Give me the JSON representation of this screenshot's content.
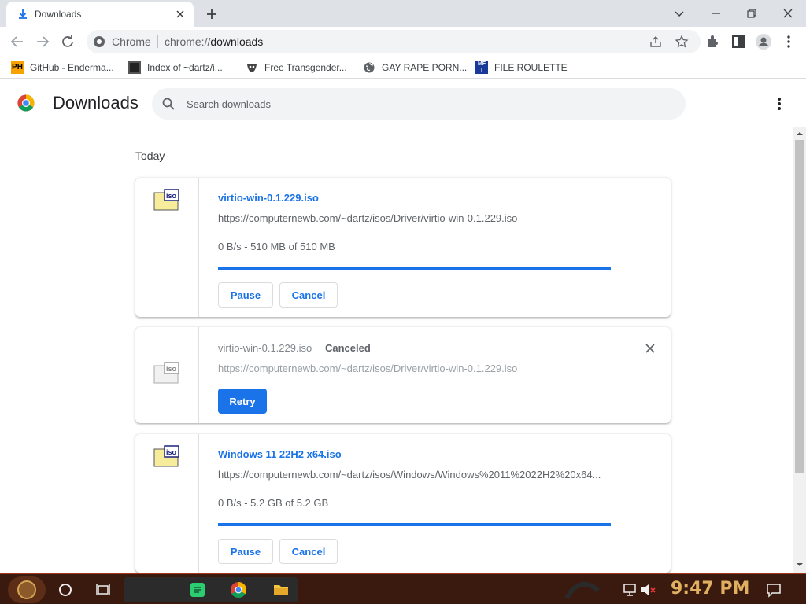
{
  "tab": {
    "title": "Downloads"
  },
  "omnibox": {
    "chip": "Chrome",
    "url_scheme": "chrome://",
    "url_path": "downloads"
  },
  "bookmarks": [
    {
      "label": "GitHub - Enderma...",
      "icon": "ph-icon"
    },
    {
      "label": "Index of ~dartz/i...",
      "icon": "folder-icon"
    },
    {
      "label": "Free Transgender...",
      "icon": "mask-icon"
    },
    {
      "label": "GAY RAPE PORN...",
      "icon": "globe-icon"
    },
    {
      "label": "FILE ROULETTE",
      "icon": "mft-icon"
    }
  ],
  "header": {
    "title": "Downloads",
    "search_placeholder": "Search downloads"
  },
  "section": {
    "label": "Today"
  },
  "downloads": [
    {
      "name": "virtio-win-0.1.229.iso",
      "url": "https://computernewb.com/~dartz/isos/Driver/virtio-win-0.1.229.iso",
      "progress_text": "0 B/s - 510 MB of 510 MB",
      "progress_fraction": 0.999,
      "pause_label": "Pause",
      "cancel_label": "Cancel"
    },
    {
      "name": "virtio-win-0.1.229.iso",
      "status": "Canceled",
      "url": "https://computernewb.com/~dartz/isos/Driver/virtio-win-0.1.229.iso",
      "retry_label": "Retry"
    },
    {
      "name": "Windows 11 22H2 x64.iso",
      "url": "https://computernewb.com/~dartz/isos/Windows/Windows%2011%2022H2%20x64...",
      "progress_text": "0 B/s - 5.2 GB of 5.2 GB",
      "progress_fraction": 0.999,
      "pause_label": "Pause",
      "cancel_label": "Cancel"
    }
  ],
  "taskbar": {
    "time": "9:47 PM"
  },
  "colors": {
    "accent": "#1a73e8",
    "taskbar": "#3a1a0f",
    "clock": "#e0b060"
  }
}
